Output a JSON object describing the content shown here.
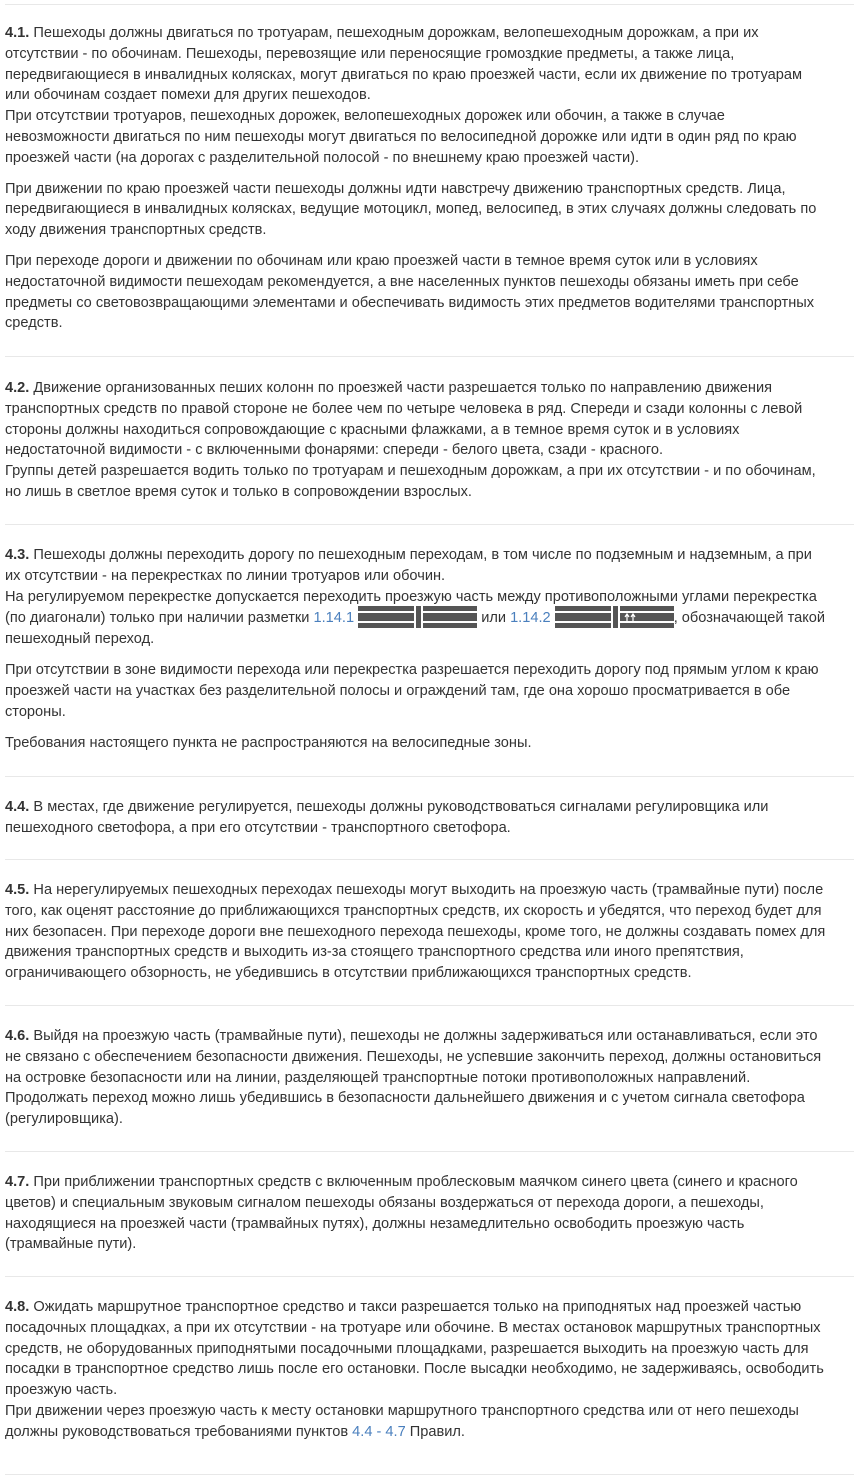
{
  "sections": [
    {
      "num": "4.1.",
      "paras": [
        [
          "Пешеходы должны двигаться по тротуарам, пешеходным дорожкам, велопешеходным дорожкам, а при их",
          "отсутствии - по обочинам. Пешеходы, перевозящие или переносящие громоздкие предметы, а также лица,",
          "передвигающиеся в инвалидных колясках, могут двигаться по краю проезжей части, если их движение по тротуарам",
          "или обочинам создает помехи для других пешеходов.",
          "При отсутствии тротуаров, пешеходных дорожек, велопешеходных дорожек или обочин, а также в случае",
          "невозможности двигаться по ним пешеходы могут двигаться по велосипедной дорожке или идти в один ряд по краю",
          "проезжей части (на дорогах с разделительной полосой - по внешнему краю проезжей части)."
        ],
        [
          "При движении по краю проезжей части пешеходы должны идти навстречу движению транспортных средств. Лица,",
          "передвигающиеся в инвалидных колясках, ведущие мотоцикл, мопед, велосипед, в этих случаях должны следовать по",
          "ходу движения транспортных средств."
        ],
        [
          "При переходе дороги и движении по обочинам или краю проезжей части в темное время суток или в условиях",
          "недостаточной видимости пешеходам рекомендуется, а вне населенных пунктов пешеходы обязаны иметь при себе",
          "предметы со световозвращающими элементами и обеспечивать видимость этих предметов водителями транспортных",
          "средств."
        ]
      ]
    },
    {
      "num": "4.2.",
      "paras": [
        [
          "Движение организованных пеших колонн по проезжей части разрешается только по направлению движения",
          "транспортных средств по правой стороне не более чем по четыре человека в ряд. Спереди и сзади колонны с левой",
          "стороны должны находиться сопровождающие с красными флажками, а в темное время суток и в условиях",
          "недостаточной видимости - с включенными фонарями: спереди - белого цвета, сзади - красного.",
          "Группы детей разрешается водить только по тротуарам и пешеходным дорожкам, а при их отсутствии - и по обочинам,",
          "но лишь в светлое время суток и только в сопровождении взрослых."
        ]
      ]
    },
    {
      "num": "4.3.",
      "paras": [
        [
          "Пешеходы должны переходить дорогу по пешеходным переходам, в том числе по подземным и надземным, а при",
          "их отсутствии - на перекрестках по линии тротуаров или обочин.",
          "На регулируемом перекрестке допускается переходить проезжую часть между противоположными углами перекрестка"
        ],
        [
          "При отсутствии в зоне видимости перехода или перекрестка разрешается переходить дорогу под прямым углом к краю",
          "проезжей части на участках без разделительной полосы и ограждений там, где она хорошо просматривается в обе",
          "стороны."
        ],
        [
          "Требования настоящего пункта не распространяются на велосипедные зоны."
        ]
      ],
      "marking_line": {
        "before": "(по диагонали) только при наличии разметки ",
        "link1": "1.14.1",
        "mid": " или ",
        "link2": "1.14.2",
        "after": ", обозначающей такой"
      },
      "marking_tail": "пешеходный переход."
    },
    {
      "num": "4.4.",
      "paras": [
        [
          "В местах, где движение регулируется, пешеходы должны руководствоваться сигналами регулировщика или",
          "пешеходного светофора, а при его отсутствии - транспортного светофора."
        ]
      ]
    },
    {
      "num": "4.5.",
      "paras": [
        [
          "На нерегулируемых пешеходных переходах пешеходы могут выходить на проезжую часть (трамвайные пути) после",
          "того, как оценят расстояние до приближающихся транспортных средств, их скорость и убедятся, что переход будет для",
          "них безопасен. При переходе дороги вне пешеходного перехода пешеходы, кроме того, не должны создавать помех для",
          "движения транспортных средств и выходить из-за стоящего транспортного средства или иного препятствия,",
          "ограничивающего обзорность, не убедившись в отсутствии приближающихся транспортных средств."
        ]
      ]
    },
    {
      "num": "4.6.",
      "paras": [
        [
          "Выйдя на проезжую часть (трамвайные пути), пешеходы не должны задерживаться или останавливаться, если это",
          "не связано с обеспечением безопасности движения. Пешеходы, не успевшие закончить переход, должны остановиться",
          "на островке безопасности или на линии, разделяющей транспортные потоки противоположных направлений.",
          "Продолжать переход можно лишь убедившись в безопасности дальнейшего движения и с учетом сигнала светофора",
          "(регулировщика)."
        ]
      ]
    },
    {
      "num": "4.7.",
      "paras": [
        [
          "При приближении транспортных средств с включенным проблесковым маячком синего цвета (синего и красного",
          "цветов) и специальным звуковым сигналом пешеходы обязаны воздержаться от перехода дороги, а пешеходы,",
          "находящиеся на проезжей части (трамвайных путях), должны незамедлительно освободить проезжую часть",
          "(трамвайные пути)."
        ]
      ]
    },
    {
      "num": "4.8.",
      "paras": [
        [
          "Ожидать маршрутное транспортное средство и такси разрешается только на приподнятых над проезжей частью",
          "посадочных площадках, а при их отсутствии - на тротуаре или обочине. В местах остановок маршрутных транспортных",
          "средств, не оборудованных приподнятыми посадочными площадками, разрешается выходить на проезжую часть для",
          "посадки в транспортное средство лишь после его остановки. После высадки необходимо, не задерживаясь, освободить",
          "проезжую часть.",
          "При движении через проезжую часть к месту остановки маршрутного транспортного средства или от него пешеходы"
        ]
      ],
      "link_line": {
        "before": "должны руководствоваться требованиями пунктов ",
        "link": "4.4 - 4.7",
        "after": " Правил."
      }
    }
  ],
  "colors": {
    "text": "#333333",
    "link": "#4a7fbd",
    "rule": "#e8e8e8",
    "marking": "#555555"
  }
}
